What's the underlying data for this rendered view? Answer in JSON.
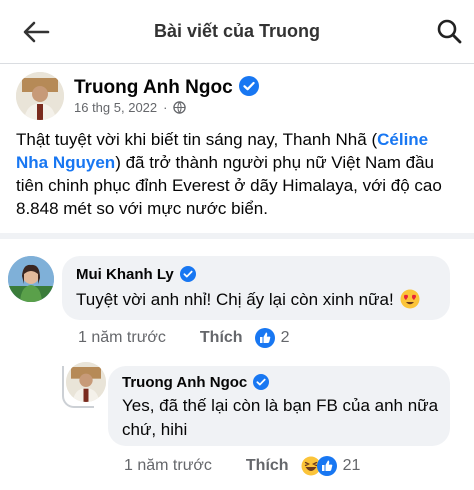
{
  "header": {
    "title": "Bài viết của Truong"
  },
  "post": {
    "author": "Truong Anh Ngoc",
    "date": "16 thg 5, 2022",
    "text_before": "Thật tuyệt vời khi biết tin sáng nay, Thanh Nhã (",
    "mention": "Céline Nha Nguyen",
    "text_after": ") đã trở thành người phụ nữ Việt Nam đầu tiên chinh phục đỉnh Everest ở dãy Himalaya, với độ cao 8.848 mét so với mực nước biển."
  },
  "comments": [
    {
      "author": "Mui Khanh Ly",
      "text": "Tuyệt vời anh nhỉ! Chị ấy lại còn xinh nữa!",
      "time": "1 năm trước",
      "like_label": "Thích",
      "reaction_count": "2"
    },
    {
      "author": "Truong Anh Ngoc",
      "text": "Yes, đã thế lại còn là bạn FB của anh nữa chứ, hihi",
      "time": "1 năm trước",
      "like_label": "Thích",
      "reaction_count": "21"
    }
  ],
  "icons": {
    "back": "arrow-left-icon",
    "search": "search-icon",
    "verified": "verified-badge-icon",
    "audience": "globe-icon",
    "like": "like-reaction-icon",
    "haha": "haha-reaction-icon",
    "heart_eyes": "heart-eyes-emoji-icon"
  },
  "colors": {
    "accent": "#1877f2",
    "muted": "#65676b",
    "bubble": "#f0f2f5"
  }
}
